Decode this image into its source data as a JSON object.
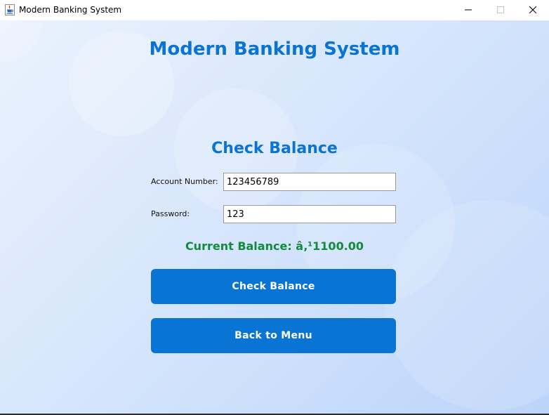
{
  "window": {
    "title": "Modern Banking System",
    "app_icon": "java-cup-icon",
    "controls": [
      "minimize-icon",
      "maximize-icon",
      "close-icon"
    ]
  },
  "main": {
    "app_heading": "Modern Banking System",
    "section_heading": "Check Balance",
    "account_label": "Account Number:",
    "account_value": "123456789",
    "password_label": "Password:",
    "password_value": "123",
    "balance_text": "Current Balance: â‚¹1100.00",
    "check_button_label": "Check Balance",
    "back_button_label": "Back to Menu"
  },
  "colors": {
    "accent": "#0a74d4",
    "success": "#138a3c",
    "background_start": "#eaf2fd",
    "background_end": "#bcd4fa"
  }
}
